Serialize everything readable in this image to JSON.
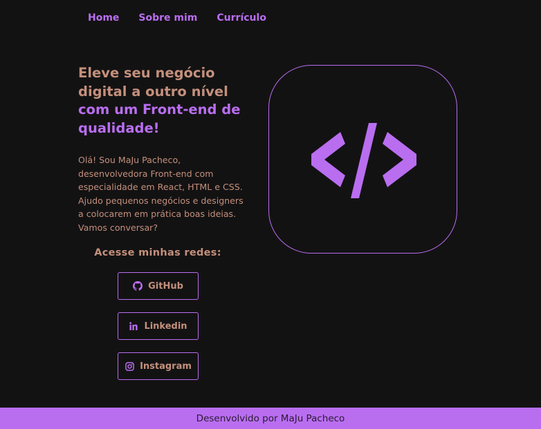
{
  "nav": {
    "items": [
      "Home",
      "Sobre mim",
      "Currículo"
    ]
  },
  "hero": {
    "title_part1": "Eleve seu negócio digital a outro nível",
    "title_part2": "com um Front-end de qualidade!",
    "intro": "Olá! Sou MaJu Pacheco, desenvolvedora Front-end com especialidade em React, HTML e CSS. Ajudo pequenos negócios e designers a colocarem em prática boas ideias. Vamos conversar?",
    "socials_title": "Acesse minhas redes:",
    "socials": [
      {
        "label": "GitHub",
        "icon": "github-icon"
      },
      {
        "label": "Linkedin",
        "icon": "linkedin-icon"
      },
      {
        "label": "Instagram",
        "icon": "instagram-icon"
      }
    ]
  },
  "illustration": {
    "icon": "code-brackets-icon"
  },
  "footer": {
    "text": "Desenvolvido por MaJu Pacheco"
  },
  "colors": {
    "background": "#131213",
    "accent_purple": "#b96ef0",
    "accent_peach": "#c4907c"
  }
}
